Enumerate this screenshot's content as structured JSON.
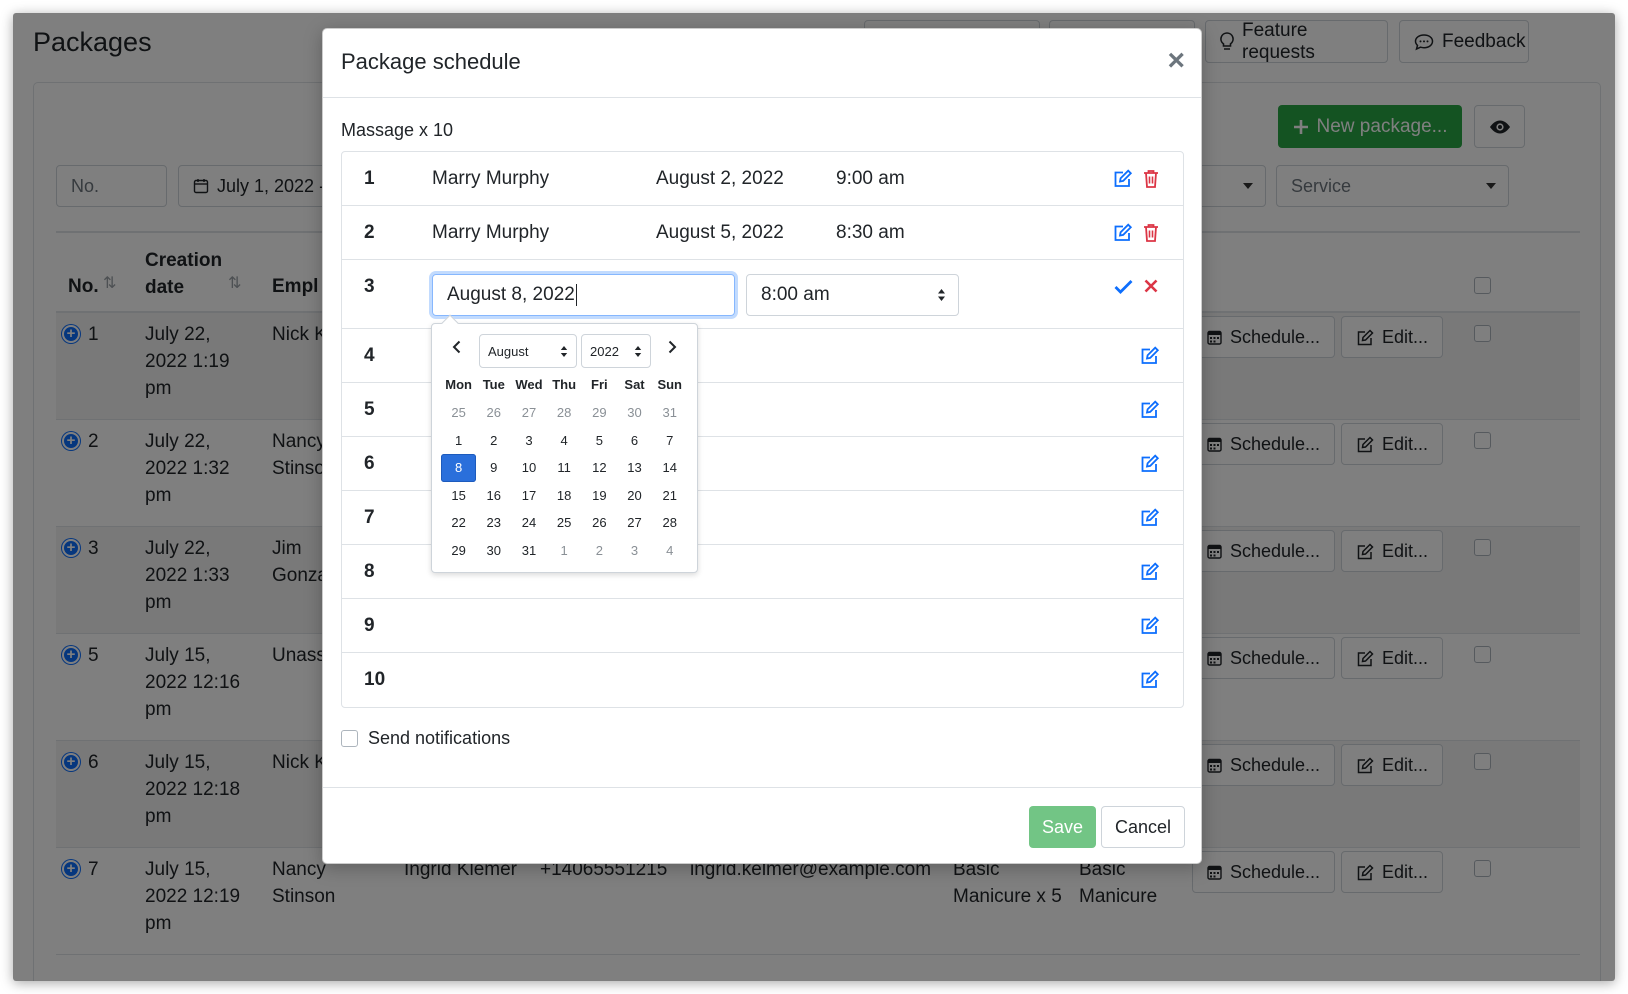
{
  "page": {
    "title": "Packages",
    "top_buttons": [
      {
        "label": "Feature requests",
        "icon": "lightbulb-icon"
      },
      {
        "label": "Feedback",
        "icon": "chat-icon"
      }
    ],
    "new_package_label": "New package...",
    "filters": {
      "number_placeholder": "No.",
      "date_range": "July 1, 2022 -",
      "service_placeholder": "Service"
    },
    "table": {
      "headers": {
        "no": "No.",
        "creation_date": "Creation date",
        "employee": "Empl"
      },
      "schedule_label": "Schedule...",
      "edit_label": "Edit...",
      "rows": [
        {
          "no": "1",
          "date": "July 22, 2022 1:19 pm",
          "employee": "Nick K"
        },
        {
          "no": "2",
          "date": "July 22, 2022 1:32 pm",
          "employee": "Nancy Stinso"
        },
        {
          "no": "3",
          "date": "July 22, 2022 1:33 pm",
          "employee": "Jim Gonza"
        },
        {
          "no": "5",
          "date": "July 15, 2022 12:16 pm",
          "employee": "Unass"
        },
        {
          "no": "6",
          "date": "July 15, 2022 12:18 pm",
          "employee": "Nick K"
        },
        {
          "no": "7",
          "date": "July 15, 2022 12:19 pm",
          "employee": "Nancy Stinson",
          "client": "Ingrid Klemer",
          "phone": "+14065551215",
          "email": "ingrid.kelmer@example.com",
          "package": "Basic Manicure x 5",
          "service": "Basic Manicure"
        }
      ]
    }
  },
  "modal": {
    "title": "Package schedule",
    "close_symbol": "×",
    "package_name": "Massage x 10",
    "sessions": [
      {
        "num": "1",
        "employee": "Marry Murphy",
        "date": "August 2, 2022",
        "time": "9:00 am"
      },
      {
        "num": "2",
        "employee": "Marry Murphy",
        "date": "August 5, 2022",
        "time": "8:30 am"
      },
      {
        "num": "3",
        "date_value": "August 8, 2022",
        "time_value": "8:00 am"
      },
      {
        "num": "4"
      },
      {
        "num": "5"
      },
      {
        "num": "6"
      },
      {
        "num": "7"
      },
      {
        "num": "8"
      },
      {
        "num": "9"
      },
      {
        "num": "10"
      }
    ],
    "datepicker": {
      "month": "August",
      "year": "2022",
      "weekdays": [
        "Mon",
        "Tue",
        "Wed",
        "Thu",
        "Fri",
        "Sat",
        "Sun"
      ],
      "weeks": [
        [
          "25",
          "26",
          "27",
          "28",
          "29",
          "30",
          "31"
        ],
        [
          "1",
          "2",
          "3",
          "4",
          "5",
          "6",
          "7"
        ],
        [
          "8",
          "9",
          "10",
          "11",
          "12",
          "13",
          "14"
        ],
        [
          "15",
          "16",
          "17",
          "18",
          "19",
          "20",
          "21"
        ],
        [
          "22",
          "23",
          "24",
          "25",
          "26",
          "27",
          "28"
        ],
        [
          "29",
          "30",
          "31",
          "1",
          "2",
          "3",
          "4"
        ]
      ],
      "selected_day": "8"
    },
    "send_notifications_label": "Send notifications",
    "save_label": "Save",
    "cancel_label": "Cancel"
  },
  "colors": {
    "primary": "#0d6efd",
    "success": "#28a745",
    "danger": "#dc3545",
    "selected_day": "#2a6fdb"
  }
}
